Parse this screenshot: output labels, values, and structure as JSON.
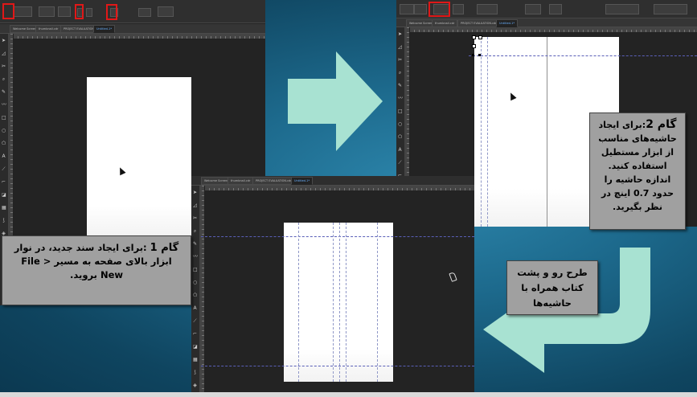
{
  "colors": {
    "app_background": "#232323",
    "toolbar": "#2f2f2f",
    "highlight_box": "#e01818",
    "arrow": "#a8e2d2",
    "callout_background": "#a0a0a0",
    "guide_line": "#5a5fb8",
    "active_tab_text": "#68b0ff"
  },
  "window_tabs": {
    "welcome": "Welcome Screen",
    "thumbnails": "thumbnail.cdr",
    "project": "PROJECT EVALUATION.cdr*",
    "untitled": "Untitled-1*"
  },
  "callouts": {
    "step1": {
      "label": "گام 1",
      "body": " :برای ایجاد سند جدید، در نوار ابزار بالای صفحه به مسیر File > New بروید."
    },
    "step2": {
      "label": "گام 2",
      "body": ":برای ایجاد حاشیه‌های مناسب از ابزار مستطیل استفاده کنید. اندازه حاشیه را حدود 0.7 اینچ در نظر بگیرید."
    },
    "step3": {
      "body": "طرح رو و پشت کتاب همراه با حاشیه‌ها"
    }
  },
  "icons": {
    "right_arrow": "right-arrow-icon",
    "return_arrow": "curved-return-arrow-icon",
    "pointer": "mouse-pointer-icon"
  }
}
